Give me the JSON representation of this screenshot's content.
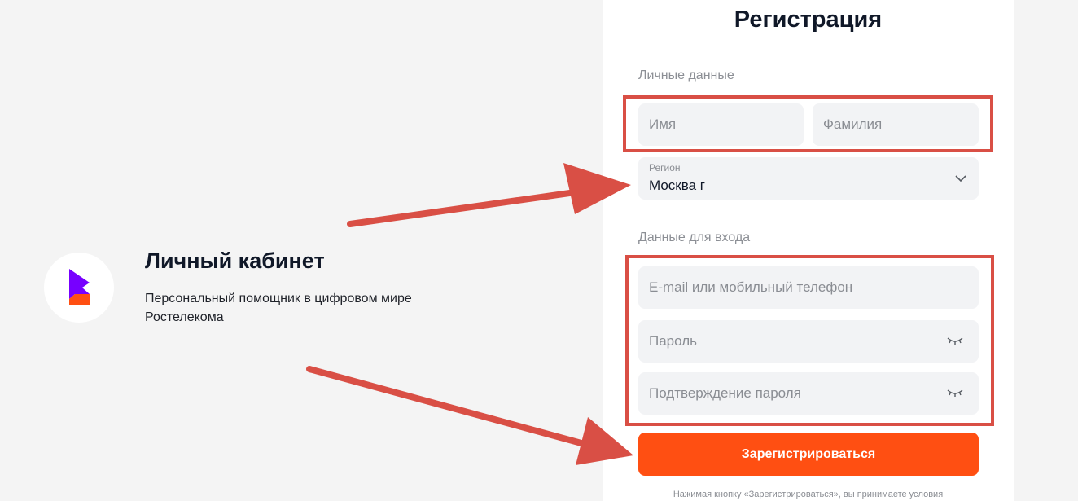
{
  "brand": {
    "title": "Личный кабинет",
    "subtitle": "Персональный помощник в цифровом мире Ростелекома",
    "logo_colors": {
      "purple": "#7700ff",
      "orange": "#ff4f12"
    }
  },
  "form": {
    "title": "Регистрация",
    "personal_section_label": "Личные данные",
    "first_name_placeholder": "Имя",
    "last_name_placeholder": "Фамилия",
    "region": {
      "label": "Регион",
      "value": "Москва г"
    },
    "login_section_label": "Данные для входа",
    "email_placeholder": "E-mail или мобильный телефон",
    "password_placeholder": "Пароль",
    "confirm_password_placeholder": "Подтверждение пароля",
    "submit_label": "Зарегистрироваться",
    "terms_text": "Нажимая кнопку «Зарегистрироваться», вы принимаете условия"
  },
  "annotations": {
    "color": "#d94f45"
  },
  "icons": [
    "rostelecom-logo-icon",
    "chevron-down-icon",
    "eye-closed-icon",
    "arrow-icon"
  ]
}
